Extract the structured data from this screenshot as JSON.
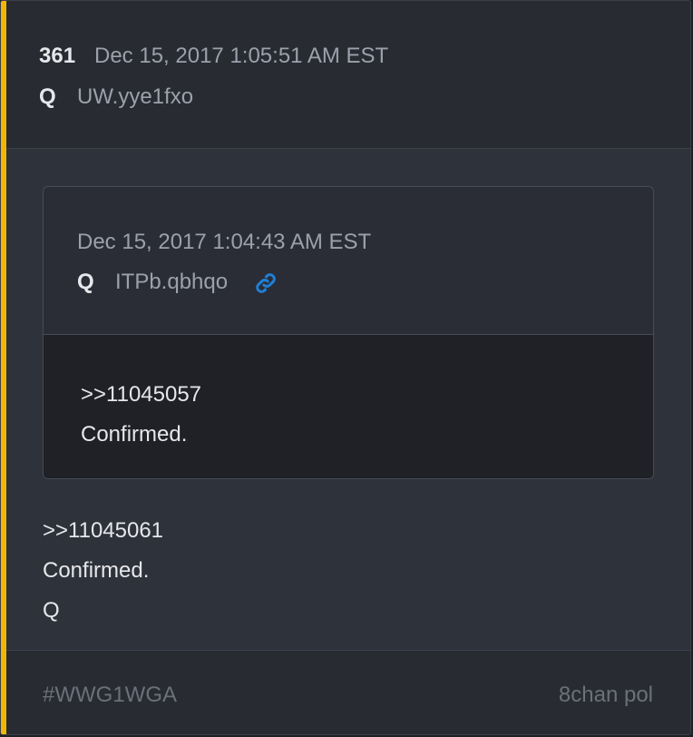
{
  "post": {
    "number": "361",
    "timestamp": "Dec 15, 2017 1:05:51 AM EST",
    "author": "Q",
    "tripcode": "UW.yye1fxo"
  },
  "quoted": {
    "timestamp": "Dec 15, 2017 1:04:43 AM EST",
    "author": "Q",
    "tripcode": "ITPb.qbhqo",
    "link_icon": "link-icon",
    "lines": [
      ">>11045057",
      "Confirmed."
    ]
  },
  "message": {
    "lines": [
      ">>11045061",
      "Confirmed.",
      "Q"
    ]
  },
  "footer": {
    "hashtag": "#WWG1WGA",
    "source": "8chan pol"
  },
  "colors": {
    "accent": "#f2b705",
    "link": "#1f7fd6"
  }
}
